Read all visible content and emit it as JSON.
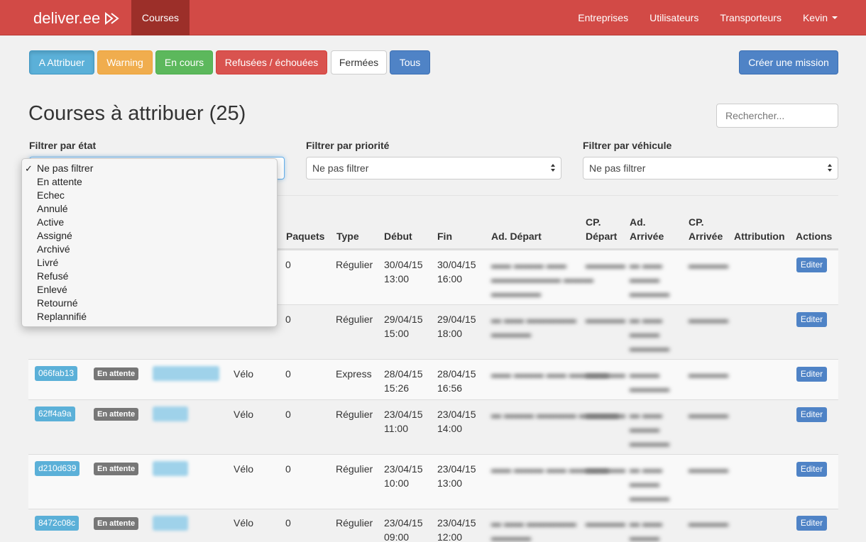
{
  "navbar": {
    "brand": "deliver.ee",
    "active": "Courses",
    "links": [
      "Entreprises",
      "Utilisateurs",
      "Transporteurs"
    ],
    "user": "Kevin"
  },
  "status_buttons": {
    "attribuer": "A Attribuer",
    "warning": "Warning",
    "en_cours": "En cours",
    "refusees": "Refusées / échouées",
    "fermees": "Fermées",
    "tous": "Tous"
  },
  "create_button": "Créer une mission",
  "title": "Courses à attribuer (25)",
  "search": {
    "placeholder": "Rechercher..."
  },
  "filters": {
    "etat": {
      "label": "Filtrer par état",
      "value": "Ne pas filtrer"
    },
    "priorite": {
      "label": "Filtrer par priorité",
      "value": "Ne pas filtrer"
    },
    "vehicule": {
      "label": "Filtrer par véhicule",
      "value": "Ne pas filtrer"
    }
  },
  "dropdown_options": [
    "Ne pas filtrer",
    "En attente",
    "Echec",
    "Annulé",
    "Active",
    "Assigné",
    "Archivé",
    "Livré",
    "Refusé",
    "Enlevé",
    "Retourné",
    "Replannifié"
  ],
  "dropdown_selected": "Ne pas filtrer",
  "table": {
    "headers": {
      "paquets": "Paquets",
      "type": "Type",
      "debut": "Début",
      "fin": "Fin",
      "ad_depart": "Ad. Départ",
      "cp_depart_1": "CP.",
      "cp_depart_2": "Départ",
      "ad_arrivee_1": "Ad.",
      "ad_arrivee_2": "Arrivée",
      "cp_arrivee_1": "CP.",
      "cp_arrivee_2": "Arrivée",
      "attribution": "Attribution",
      "actions": "Actions"
    },
    "rows": [
      {
        "id": "",
        "state": "",
        "vehicle": "",
        "paquets": "0",
        "type": "Régulier",
        "debut_date": "30/04/15",
        "debut_time": "13:00",
        "fin_date": "30/04/15",
        "fin_time": "16:00",
        "action": "Editer"
      },
      {
        "id": "",
        "state": "",
        "vehicle": "",
        "paquets": "0",
        "type": "Régulier",
        "debut_date": "29/04/15",
        "debut_time": "15:00",
        "fin_date": "29/04/15",
        "fin_time": "18:00",
        "action": "Editer"
      },
      {
        "id": "066fab13",
        "state": "En attente",
        "vehicle": "Vélo",
        "paquets": "0",
        "type": "Express",
        "debut_date": "28/04/15",
        "debut_time": "15:26",
        "fin_date": "28/04/15",
        "fin_time": "16:56",
        "action": "Editer"
      },
      {
        "id": "62ff4a9a",
        "state": "En attente",
        "vehicle": "Vélo",
        "paquets": "0",
        "type": "Régulier",
        "debut_date": "23/04/15",
        "debut_time": "11:00",
        "fin_date": "23/04/15",
        "fin_time": "14:00",
        "action": "Editer"
      },
      {
        "id": "d210d639",
        "state": "En attente",
        "vehicle": "Vélo",
        "paquets": "0",
        "type": "Régulier",
        "debut_date": "23/04/15",
        "debut_time": "10:00",
        "fin_date": "23/04/15",
        "fin_time": "13:00",
        "action": "Editer"
      },
      {
        "id": "8472c08c",
        "state": "En attente",
        "vehicle": "Vélo",
        "paquets": "0",
        "type": "Régulier",
        "debut_date": "23/04/15",
        "debut_time": "09:00",
        "fin_date": "23/04/15",
        "fin_time": "12:00",
        "action": "Editer"
      }
    ]
  }
}
